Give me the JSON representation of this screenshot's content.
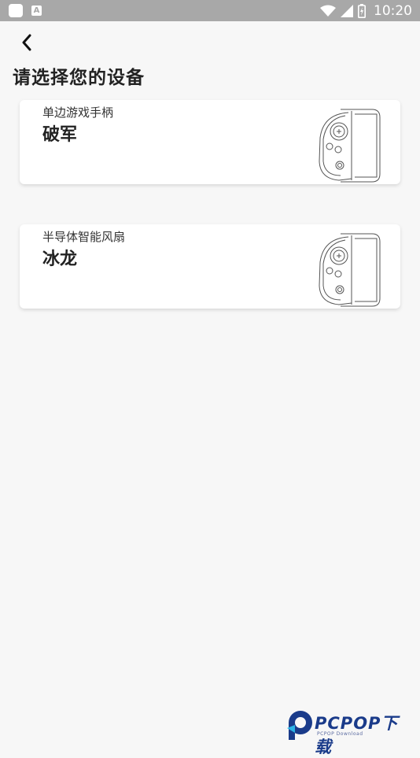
{
  "status_bar": {
    "time": "10:20",
    "notif_icon_letter": "A"
  },
  "page": {
    "title": "请选择您的设备"
  },
  "devices": [
    {
      "category": "单边游戏手柄",
      "name": "破军"
    },
    {
      "category": "半导体智能风扇",
      "name": "冰龙"
    }
  ],
  "watermark": {
    "brand": "PCPOP下载",
    "sub": "PCPOP Download"
  },
  "colors": {
    "status_bar": "#a8a8a8",
    "background": "#f7f7f7",
    "card": "#ffffff",
    "watermark_blue": "#1a3b8a"
  }
}
